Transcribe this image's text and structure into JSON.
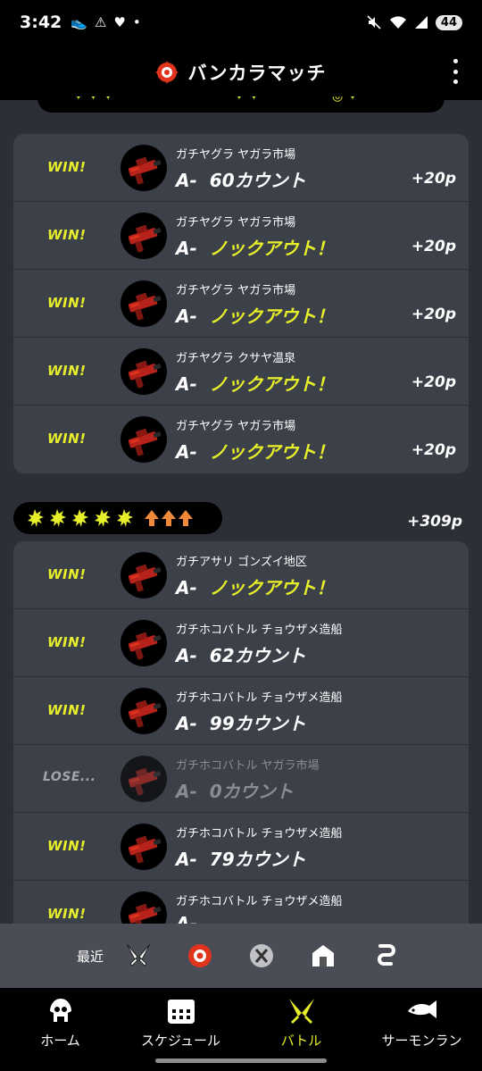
{
  "status_bar": {
    "time": "3:42",
    "battery": "44"
  },
  "header": {
    "title": "バンカラマッチ"
  },
  "first_card": [
    {
      "result": "WIN!",
      "mode": "ガチヤグラ ヤガラ市場",
      "rank": "A-",
      "score": "60カウント",
      "ko": false,
      "points": "+20p"
    },
    {
      "result": "WIN!",
      "mode": "ガチヤグラ ヤガラ市場",
      "rank": "A-",
      "score": "ノックアウト！",
      "ko": true,
      "points": "+20p"
    },
    {
      "result": "WIN!",
      "mode": "ガチヤグラ ヤガラ市場",
      "rank": "A-",
      "score": "ノックアウト！",
      "ko": true,
      "points": "+20p"
    },
    {
      "result": "WIN!",
      "mode": "ガチヤグラ クサヤ温泉",
      "rank": "A-",
      "score": "ノックアウト！",
      "ko": true,
      "points": "+20p"
    },
    {
      "result": "WIN!",
      "mode": "ガチヤグラ ヤガラ市場",
      "rank": "A-",
      "score": "ノックアウト！",
      "ko": true,
      "points": "+20p"
    }
  ],
  "series": {
    "points": "+309p",
    "win_marks": 5,
    "arrows": 3
  },
  "second_card": [
    {
      "result": "WIN!",
      "mode": "ガチアサリ ゴンズイ地区",
      "rank": "A-",
      "score": "ノックアウト！",
      "ko": true
    },
    {
      "result": "WIN!",
      "mode": "ガチホコバトル チョウザメ造船",
      "rank": "A-",
      "score": "62カウント",
      "ko": false
    },
    {
      "result": "WIN!",
      "mode": "ガチホコバトル チョウザメ造船",
      "rank": "A-",
      "score": "99カウント",
      "ko": false
    },
    {
      "result": "LOSE...",
      "mode": "ガチホコバトル ヤガラ市場",
      "rank": "A-",
      "score": "0カウント",
      "ko": false,
      "lost": true
    },
    {
      "result": "WIN!",
      "mode": "ガチホコバトル チョウザメ造船",
      "rank": "A-",
      "score": "79カウント",
      "ko": false
    },
    {
      "result": "WIN!",
      "mode": "ガチホコバトル チョウザメ造船",
      "rank": "A-",
      "score": "",
      "ko": false
    }
  ],
  "recent_bar": {
    "label": "最近",
    "icons": [
      "regular-battle-icon",
      "anarchy-battle-icon",
      "x-battle-icon",
      "private-battle-icon",
      "challenge-icon"
    ]
  },
  "bottom_nav": [
    {
      "label": "ホーム",
      "icon": "squid-home-icon"
    },
    {
      "label": "スケジュール",
      "icon": "calendar-icon"
    },
    {
      "label": "バトル",
      "icon": "battle-icon",
      "active": true
    },
    {
      "label": "サーモンラン",
      "icon": "salmon-icon"
    }
  ],
  "colors": {
    "accent": "#e6ef2a",
    "card": "#3c4049",
    "background": "#2c2f36",
    "brand_red": "#e0341d"
  }
}
